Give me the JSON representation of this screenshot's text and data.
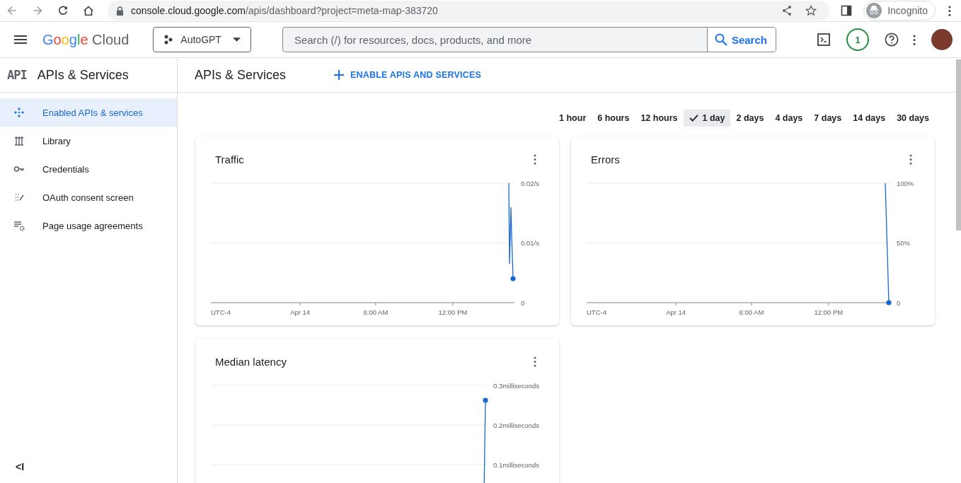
{
  "browser": {
    "url_host": "console.cloud.google.com",
    "url_path": "/apis/dashboard?project=meta-map-383720",
    "profile": "Incognito"
  },
  "header": {
    "logo_brand": "Google",
    "logo_product": "Cloud",
    "project": "AutoGPT",
    "search_placeholder": "Search (/) for resources, docs, products, and more",
    "search_button": "Search",
    "notification_count": "1"
  },
  "sidebar": {
    "badge": "API",
    "title": "APIs & Services",
    "items": [
      {
        "label": "Enabled APIs & services",
        "selected": true
      },
      {
        "label": "Library",
        "selected": false
      },
      {
        "label": "Credentials",
        "selected": false
      },
      {
        "label": "OAuth consent screen",
        "selected": false
      },
      {
        "label": "Page usage agreements",
        "selected": false
      }
    ],
    "collapse": "<I"
  },
  "page": {
    "title": "APIs & Services",
    "action": "ENABLE APIS AND SERVICES"
  },
  "time_ranges": [
    {
      "label": "1 hour",
      "selected": false
    },
    {
      "label": "6 hours",
      "selected": false
    },
    {
      "label": "12 hours",
      "selected": false
    },
    {
      "label": "1 day",
      "selected": true
    },
    {
      "label": "2 days",
      "selected": false
    },
    {
      "label": "4 days",
      "selected": false
    },
    {
      "label": "7 days",
      "selected": false
    },
    {
      "label": "14 days",
      "selected": false
    },
    {
      "label": "30 days",
      "selected": false
    }
  ],
  "cards": [
    {
      "title": "Traffic",
      "y_labels": [
        "0.02/s",
        "0.01/s",
        "0"
      ],
      "x_labels": [
        "UTC-4",
        "Apr 14",
        "6:00 AM",
        "12:00 PM"
      ]
    },
    {
      "title": "Errors",
      "y_labels": [
        "100%",
        "50%",
        "0"
      ],
      "x_labels": [
        "UTC-4",
        "Apr 14",
        "6:00 AM",
        "12:00 PM"
      ]
    },
    {
      "title": "Median latency",
      "y_labels": [
        "0.3milliseconds",
        "0.2milliseconds",
        "0.1milliseconds"
      ]
    }
  ]
}
